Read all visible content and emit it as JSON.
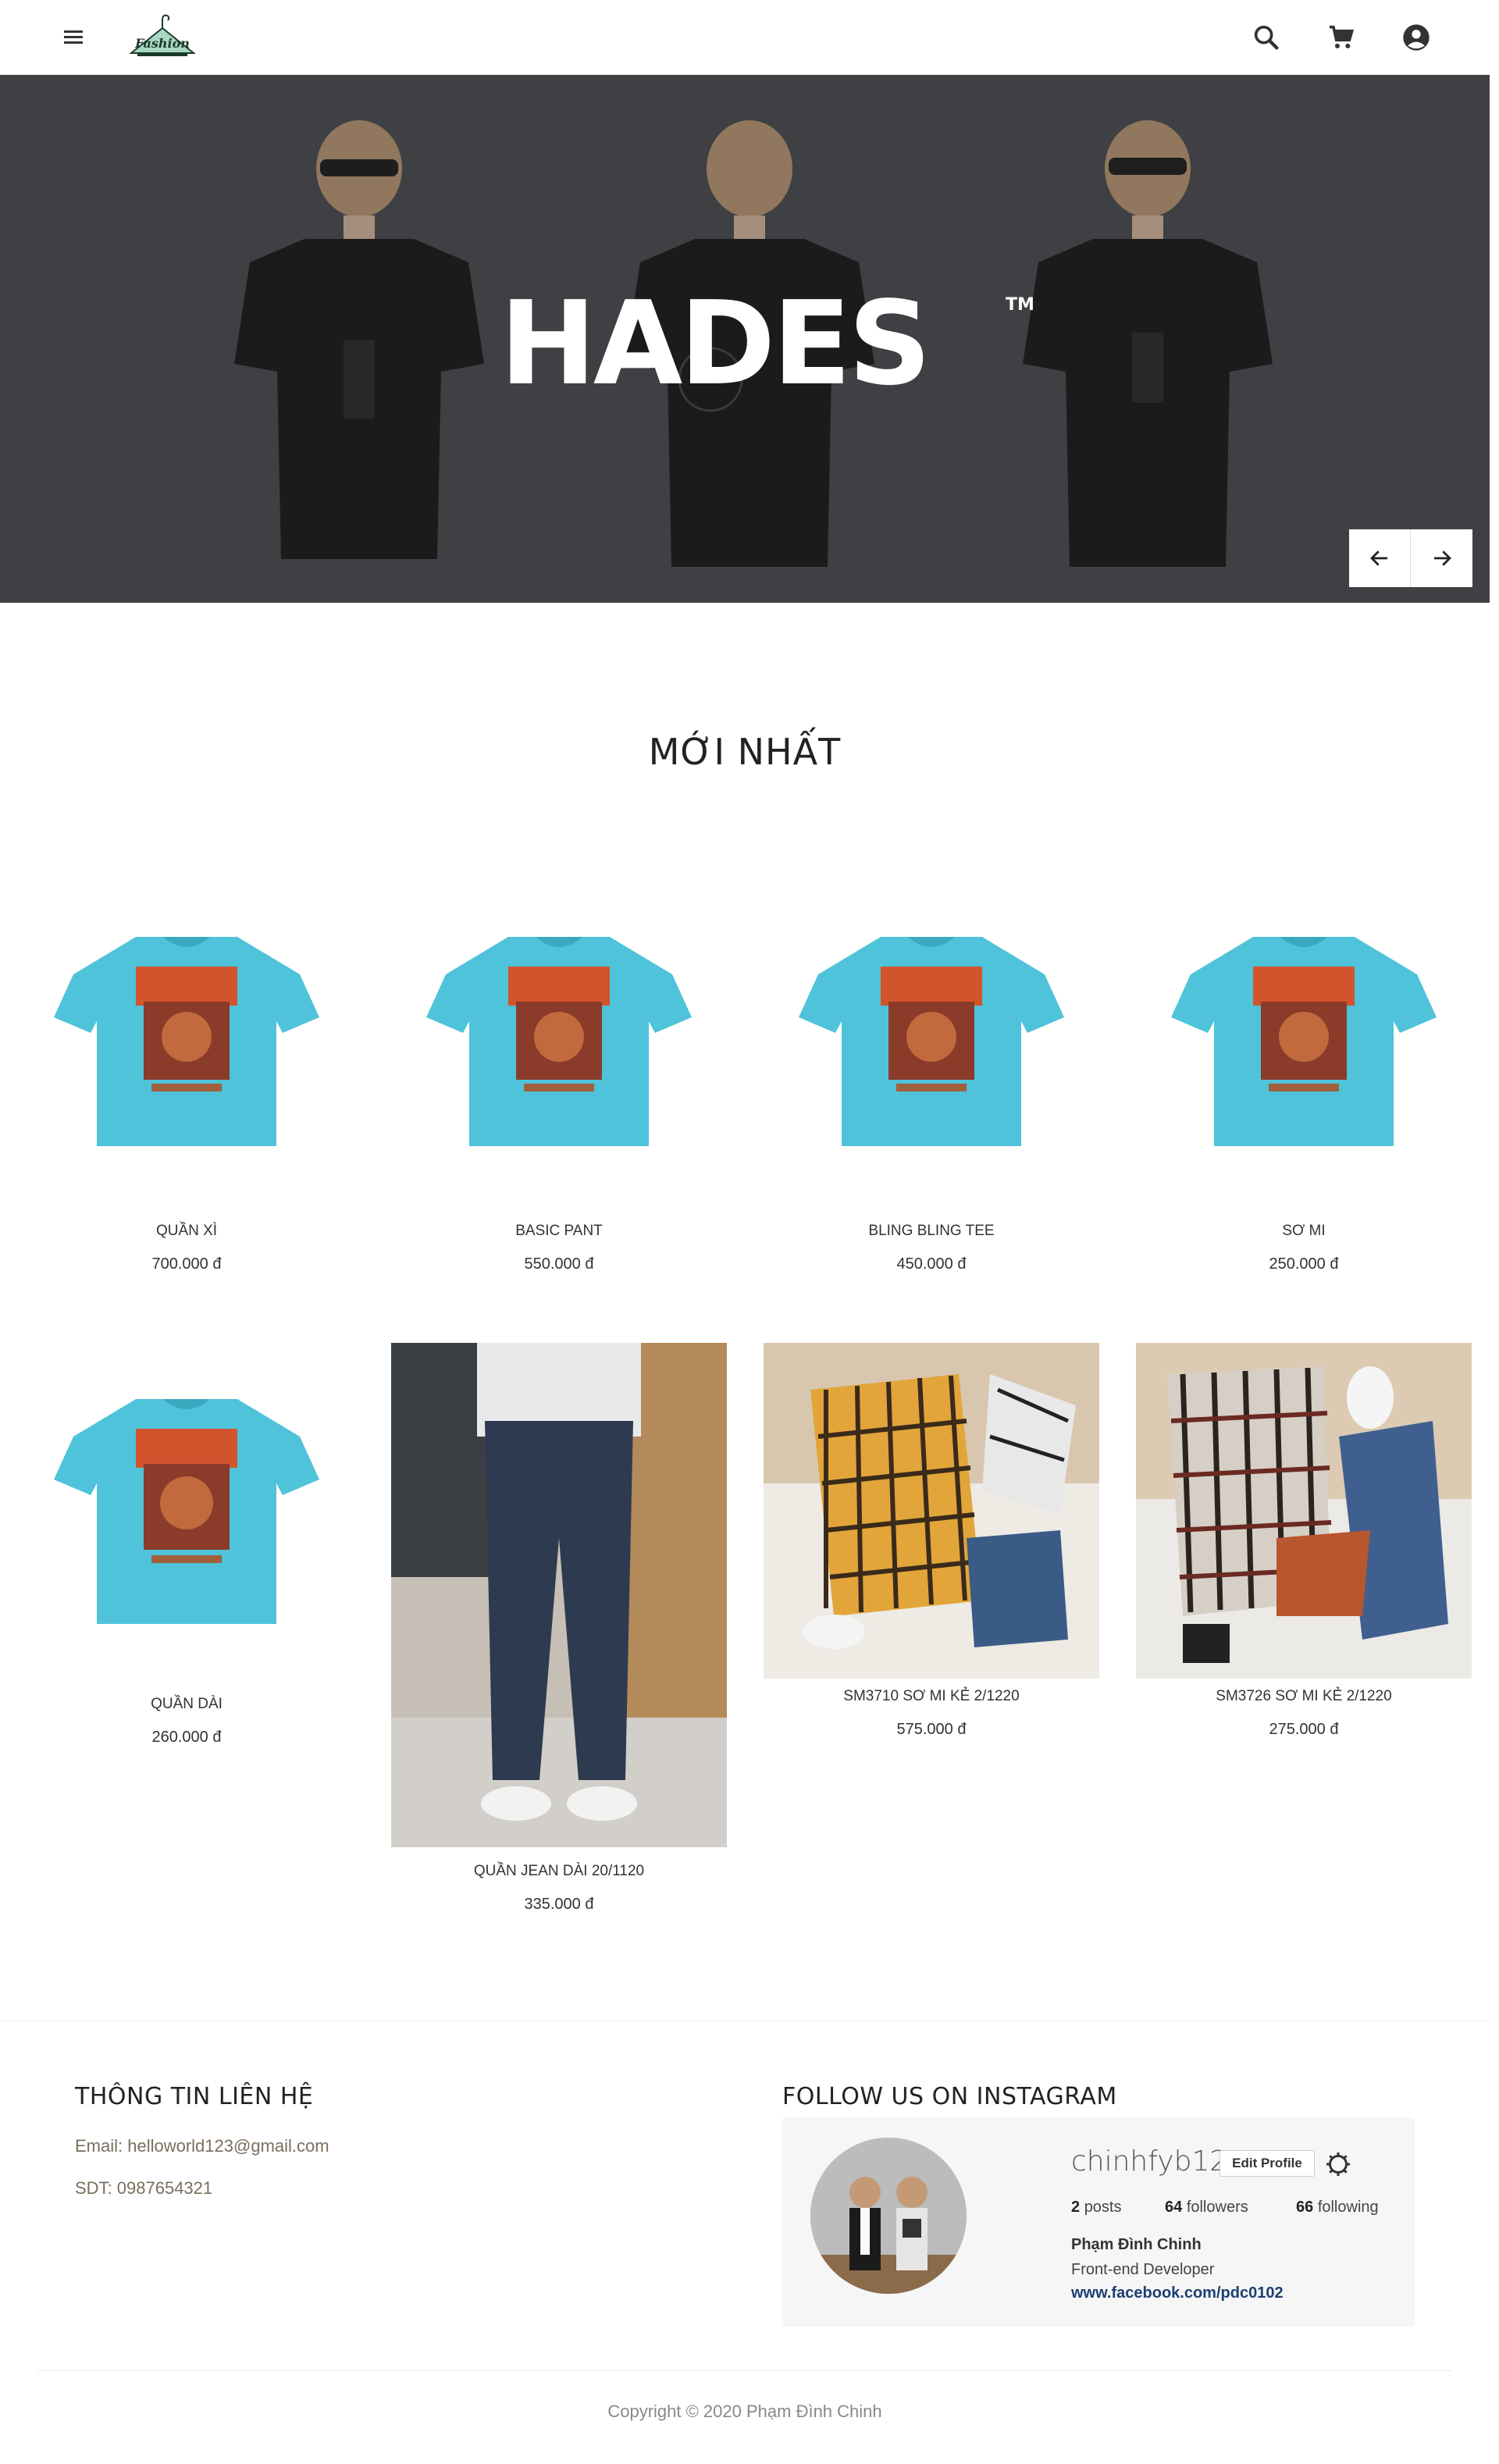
{
  "header": {
    "logo_text": "Fashion",
    "icons": [
      "menu-icon",
      "search-icon",
      "cart-icon",
      "account-icon"
    ]
  },
  "hero": {
    "brand": "HADES",
    "trademark": "TM",
    "prev_icon": "arrow-left-icon",
    "next_icon": "arrow-right-icon"
  },
  "section": {
    "title": "MỚI NHẤT"
  },
  "products": [
    {
      "name": "QUẦN XÌ",
      "price": "700.000 đ",
      "image": "blue-tshirt"
    },
    {
      "name": "BASIC PANT",
      "price": "550.000 đ",
      "image": "blue-tshirt"
    },
    {
      "name": "BLING BLING TEE",
      "price": "450.000 đ",
      "image": "blue-tshirt"
    },
    {
      "name": "SƠ MI",
      "price": "250.000 đ",
      "image": "blue-tshirt"
    },
    {
      "name": "QUẦN DÀI",
      "price": "260.000 đ",
      "image": "blue-tshirt"
    },
    {
      "name": "QUẦN JEAN DÀI 20/1120",
      "price": "335.000 đ",
      "image": "jeans-photo"
    },
    {
      "name": "SM3710 SƠ MI KẺ 2/1220",
      "price": "575.000 đ",
      "image": "plaid-shirt-photo"
    },
    {
      "name": "SM3726 SƠ MI KẺ 2/1220",
      "price": "275.000 đ",
      "image": "plaid-shirt-photo"
    }
  ],
  "contact": {
    "title": "THÔNG TIN LIÊN HỆ",
    "email": "Email: helloworld123@gmail.com",
    "phone": "SDT: 0987654321"
  },
  "instagram": {
    "title": "FOLLOW US ON INSTAGRAM",
    "username": "chinhfyb12",
    "edit_label": "Edit Profile",
    "posts_count": "2",
    "posts_label": "posts",
    "followers_count": "64",
    "followers_label": "followers",
    "following_count": "66",
    "following_label": "following",
    "name": "Phạm Đình Chinh",
    "role": "Front-end Developer",
    "link": "www.facebook.com/pdc0102"
  },
  "footer": {
    "copyright": "Copyright © 2020 Phạm Đình Chinh"
  },
  "colors": {
    "accent_link": "#1c3f72",
    "shirt_blue": "#4fc3d9",
    "hero_bg": "#4b4d50"
  }
}
